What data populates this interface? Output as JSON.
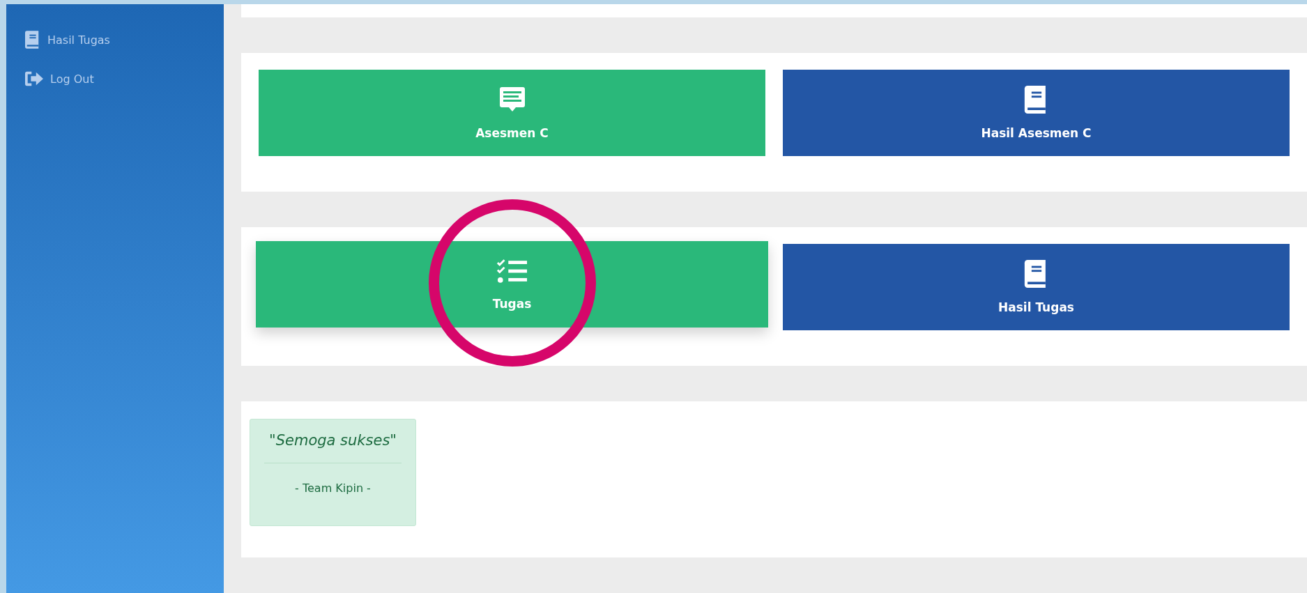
{
  "sidebar": {
    "items": [
      {
        "label": "Hasil Tugas",
        "kind": "book"
      },
      {
        "label": "Log Out",
        "kind": "logout"
      }
    ]
  },
  "panels": [
    {
      "tiles": [
        {
          "label": "Asesmen C",
          "kind": "chat",
          "color": "#2ab87a",
          "highlighted": false
        },
        {
          "label": "Hasil Asesmen C",
          "kind": "book",
          "color": "#2356a5",
          "highlighted": false
        }
      ]
    },
    {
      "tiles": [
        {
          "label": "Tugas",
          "kind": "checklist",
          "color": "#2ab87a",
          "highlighted": true
        },
        {
          "label": "Hasil Tugas",
          "kind": "book",
          "color": "#2356a5",
          "highlighted": false
        }
      ]
    }
  ],
  "quote": {
    "text": "\"Semoga sukses\"",
    "author": "- Team Kipin -"
  }
}
